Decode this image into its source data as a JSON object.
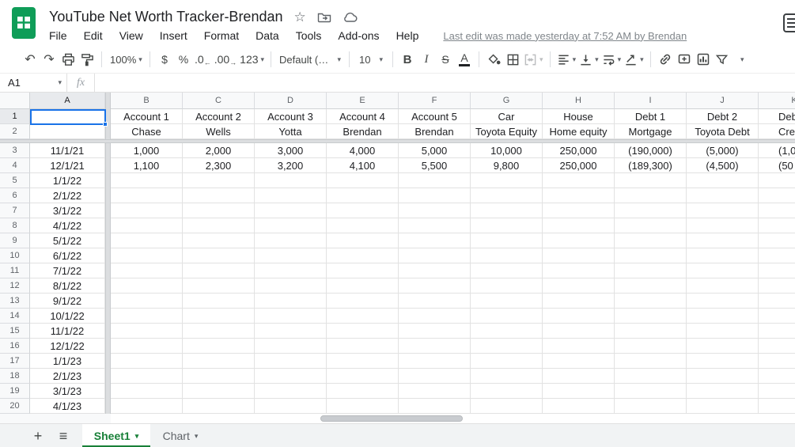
{
  "colors": {
    "logo_green": "#0f9d58",
    "accent_green": "#188038",
    "selection_blue": "#1a73e8"
  },
  "header": {
    "title": "YouTube Net Worth Tracker-Brendan",
    "menu_items": [
      "File",
      "Edit",
      "View",
      "Insert",
      "Format",
      "Data",
      "Tools",
      "Add-ons",
      "Help"
    ],
    "last_edit": "Last edit was made yesterday at 7:52 AM by Brendan"
  },
  "icons": {
    "undo": "↶",
    "redo": "↷",
    "star": "☆",
    "caret": "▾",
    "decrease_decimal_arrow": "←",
    "increase_decimal_arrow": "→",
    "add_sheet": "+",
    "all_sheets": "≡"
  },
  "toolbar": {
    "zoom_value": "100%",
    "currency_label": "$",
    "percent_label": "%",
    "decrease_decimal_label": ".0",
    "increase_decimal_label": ".00",
    "more_formats_label": "123",
    "font_family_value": "Default (Ari...",
    "font_size_value": "10",
    "bold_label": "B",
    "italic_label": "I",
    "strikethrough_label": "S",
    "text_color_label": "A"
  },
  "formula_bar": {
    "name_box_value": "A1",
    "fx_label": "fx",
    "input_value": ""
  },
  "grid": {
    "selected_cell": "A1",
    "column_letters": [
      "A",
      "B",
      "C",
      "D",
      "E",
      "F",
      "G",
      "H",
      "I",
      "J",
      "K"
    ],
    "rows": [
      {
        "num": "1",
        "cells": [
          "",
          "Account 1",
          "Account 2",
          "Account 3",
          "Account 4",
          "Account 5",
          "Car",
          "House",
          "Debt 1",
          "Debt 2",
          "Deb"
        ]
      },
      {
        "num": "2",
        "cells": [
          "",
          "Chase",
          "Wells",
          "Yotta",
          "Brendan",
          "Brendan",
          "Toyota Equity",
          "Home equity",
          "Mortgage",
          "Toyota Debt",
          "Credit"
        ]
      },
      {
        "num": "3",
        "cells": [
          "11/1/21",
          "1,000",
          "2,000",
          "3,000",
          "4,000",
          "5,000",
          "10,000",
          "250,000",
          "(190,000)",
          "(5,000)",
          "(1,0"
        ]
      },
      {
        "num": "4",
        "cells": [
          "12/1/21",
          "1,100",
          "2,300",
          "3,200",
          "4,100",
          "5,500",
          "9,800",
          "250,000",
          "(189,300)",
          "(4,500)",
          "(50"
        ]
      },
      {
        "num": "5",
        "cells": [
          "1/1/22",
          "",
          "",
          "",
          "",
          "",
          "",
          "",
          "",
          "",
          ""
        ]
      },
      {
        "num": "6",
        "cells": [
          "2/1/22",
          "",
          "",
          "",
          "",
          "",
          "",
          "",
          "",
          "",
          ""
        ]
      },
      {
        "num": "7",
        "cells": [
          "3/1/22",
          "",
          "",
          "",
          "",
          "",
          "",
          "",
          "",
          "",
          ""
        ]
      },
      {
        "num": "8",
        "cells": [
          "4/1/22",
          "",
          "",
          "",
          "",
          "",
          "",
          "",
          "",
          "",
          ""
        ]
      },
      {
        "num": "9",
        "cells": [
          "5/1/22",
          "",
          "",
          "",
          "",
          "",
          "",
          "",
          "",
          "",
          ""
        ]
      },
      {
        "num": "10",
        "cells": [
          "6/1/22",
          "",
          "",
          "",
          "",
          "",
          "",
          "",
          "",
          "",
          ""
        ]
      },
      {
        "num": "11",
        "cells": [
          "7/1/22",
          "",
          "",
          "",
          "",
          "",
          "",
          "",
          "",
          "",
          ""
        ]
      },
      {
        "num": "12",
        "cells": [
          "8/1/22",
          "",
          "",
          "",
          "",
          "",
          "",
          "",
          "",
          "",
          ""
        ]
      },
      {
        "num": "13",
        "cells": [
          "9/1/22",
          "",
          "",
          "",
          "",
          "",
          "",
          "",
          "",
          "",
          ""
        ]
      },
      {
        "num": "14",
        "cells": [
          "10/1/22",
          "",
          "",
          "",
          "",
          "",
          "",
          "",
          "",
          "",
          ""
        ]
      },
      {
        "num": "15",
        "cells": [
          "11/1/22",
          "",
          "",
          "",
          "",
          "",
          "",
          "",
          "",
          "",
          ""
        ]
      },
      {
        "num": "16",
        "cells": [
          "12/1/22",
          "",
          "",
          "",
          "",
          "",
          "",
          "",
          "",
          "",
          ""
        ]
      },
      {
        "num": "17",
        "cells": [
          "1/1/23",
          "",
          "",
          "",
          "",
          "",
          "",
          "",
          "",
          "",
          ""
        ]
      },
      {
        "num": "18",
        "cells": [
          "2/1/23",
          "",
          "",
          "",
          "",
          "",
          "",
          "",
          "",
          "",
          ""
        ]
      },
      {
        "num": "19",
        "cells": [
          "3/1/23",
          "",
          "",
          "",
          "",
          "",
          "",
          "",
          "",
          "",
          ""
        ]
      },
      {
        "num": "20",
        "cells": [
          "4/1/23",
          "",
          "",
          "",
          "",
          "",
          "",
          "",
          "",
          "",
          ""
        ]
      }
    ]
  },
  "sheet_tabs": {
    "tabs": [
      {
        "label": "Sheet1",
        "active": true
      },
      {
        "label": "Chart",
        "active": false
      }
    ]
  }
}
